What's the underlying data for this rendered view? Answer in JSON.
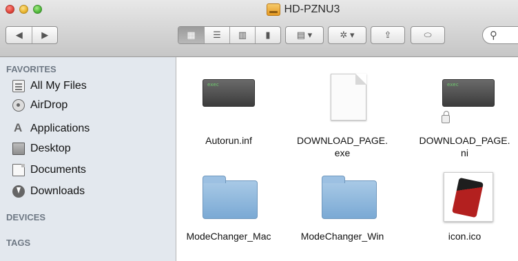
{
  "window": {
    "title": "HD-PZNU3"
  },
  "toolbar": {
    "back_glyph": "◀",
    "forward_glyph": "▶",
    "view_icon_glyph": "▦",
    "view_list_glyph": "☰",
    "view_column_glyph": "▥",
    "view_coverflow_glyph": "▮",
    "arrange_glyph": "▤ ▾",
    "action_glyph": "✲ ▾",
    "share_glyph": "⇪",
    "tag_glyph": "⬭",
    "search_glyph": "⚲"
  },
  "sidebar": {
    "favorites_title": "FAVORITES",
    "items": [
      {
        "label": "All My Files",
        "icon": "all-files-icon"
      },
      {
        "label": "AirDrop",
        "icon": "airdrop-icon"
      },
      {
        "label": "Applications",
        "icon": "applications-icon"
      },
      {
        "label": "Desktop",
        "icon": "desktop-icon"
      },
      {
        "label": "Documents",
        "icon": "documents-icon"
      },
      {
        "label": "Downloads",
        "icon": "downloads-icon"
      }
    ],
    "devices_title": "DEVICES",
    "tags_title": "TAGS"
  },
  "files": [
    {
      "name": "Autorun.inf",
      "icon": "terminal-file-icon"
    },
    {
      "name_line1": "DOWNLOAD_PAGE.",
      "name_line2": "exe",
      "icon": "blank-document-icon"
    },
    {
      "name_line1": "DOWNLOAD_PAGE.",
      "name_line2": "ni",
      "icon": "locked-terminal-file-icon"
    },
    {
      "name": "ModeChanger_Mac",
      "icon": "folder-icon"
    },
    {
      "name": "ModeChanger_Win",
      "icon": "folder-icon"
    },
    {
      "name": "icon.ico",
      "icon": "image-thumbnail-icon"
    }
  ]
}
